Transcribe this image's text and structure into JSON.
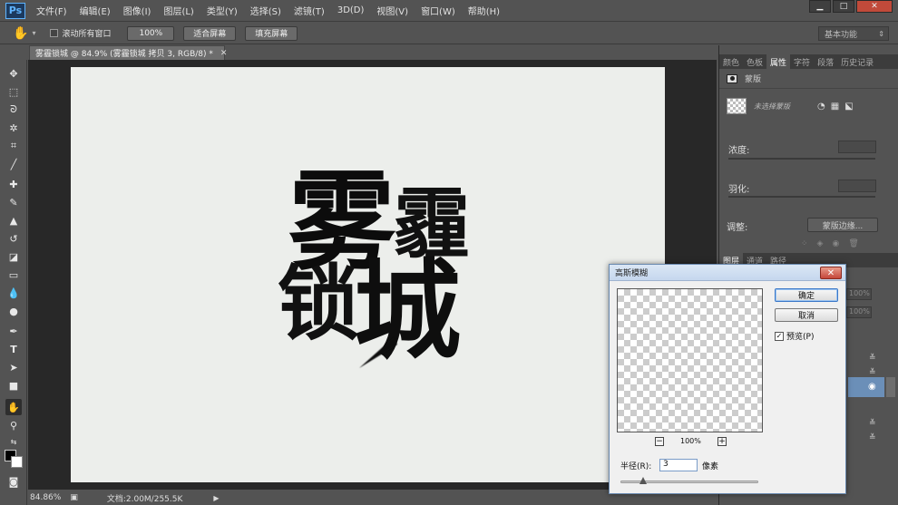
{
  "app": {
    "logo": "Ps",
    "menu": [
      "文件(F)",
      "编辑(E)",
      "图像(I)",
      "图层(L)",
      "类型(Y)",
      "选择(S)",
      "滤镜(T)",
      "3D(D)",
      "视图(V)",
      "窗口(W)",
      "帮助(H)"
    ]
  },
  "options_bar": {
    "scroll_all_label": "滚动所有窗口",
    "zoom_100": "100%",
    "fit_screen": "适合屏幕",
    "fill_screen": "填充屏幕",
    "workspace": "基本功能"
  },
  "document": {
    "tab_title": "雾霾锁城 @ 84.9% (雾霾锁城 拷贝 3, RGB/8) *",
    "artwork_chars": [
      "雾",
      "霾",
      "锁",
      "城"
    ]
  },
  "status": {
    "zoom": "84.86%",
    "doc_info": "文档:2.00M/255.5K"
  },
  "right_panel": {
    "tabs": [
      "颜色",
      "色板",
      "属性",
      "字符",
      "段落",
      "历史记录"
    ],
    "active_tab": "属性",
    "mask_label": "蒙版",
    "no_mask_selected": "未选择蒙版",
    "density_label": "浓度:",
    "feather_label": "羽化:",
    "adjust_label": "调整:",
    "mask_edge_button": "蒙版边缘...",
    "layers_tabs": [
      "图层",
      "通道",
      "路径"
    ],
    "opacity_value": "100%",
    "fill_value": "100%"
  },
  "dialog": {
    "title": "高斯模糊",
    "ok": "确定",
    "cancel": "取消",
    "preview_label": "预览(P)",
    "preview_checked": true,
    "zoom_level": "100%",
    "radius_label": "半径(R):",
    "radius_value": "3",
    "unit": "像素"
  }
}
